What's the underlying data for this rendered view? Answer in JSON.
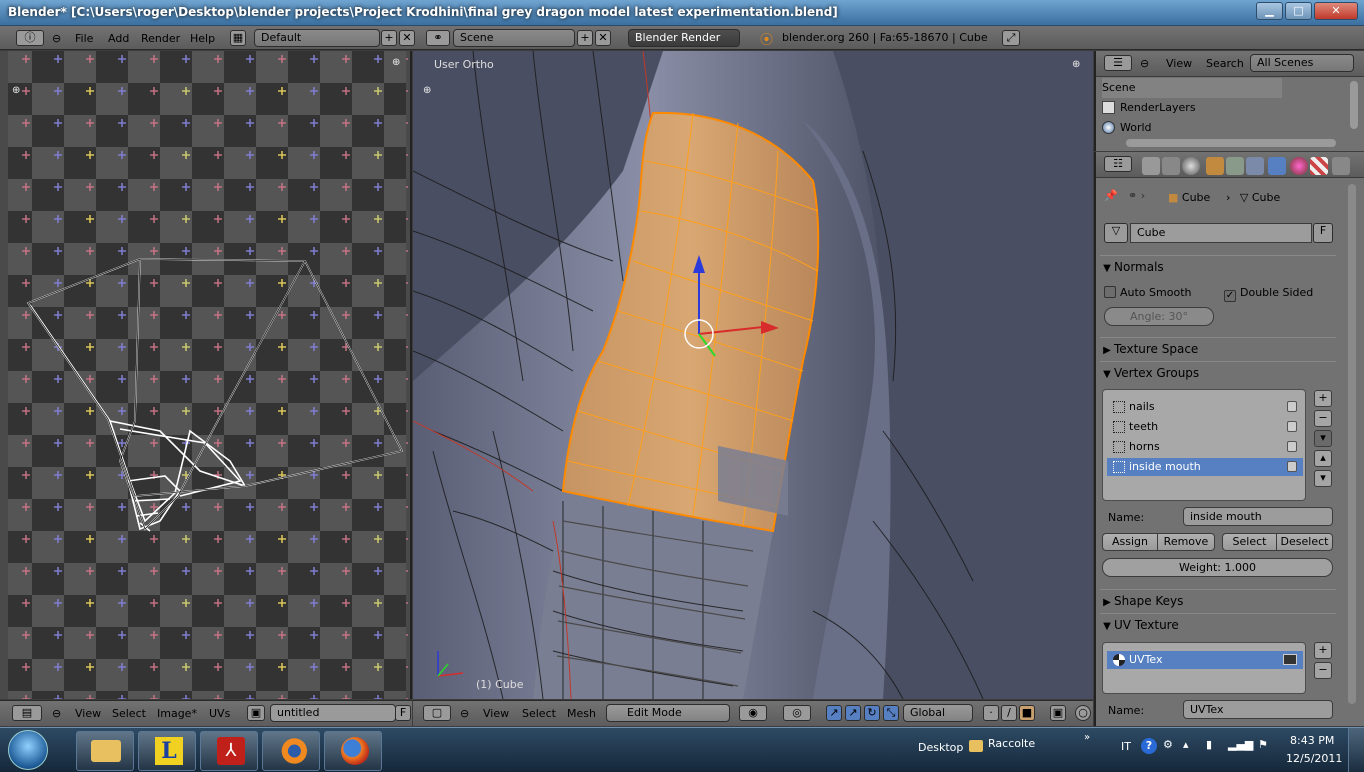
{
  "window": {
    "title": "Blender* [C:\\Users\\roger\\Desktop\\blender projects\\Project Krodhini\\final grey dragon model latest experimentation.blend]",
    "minimize": "▁",
    "maximize": "□",
    "close": "✕"
  },
  "menubar": {
    "items": [
      "File",
      "Add",
      "Render",
      "Help"
    ],
    "layout": "Default",
    "scene": "Scene",
    "engine": "Blender Render",
    "info": "blender.org 260 | Fa:65-18670 | Cube"
  },
  "uv_editor": {
    "menus": [
      "View",
      "Select",
      "Image*",
      "UVs"
    ],
    "image_name": "untitled",
    "fake_user": "F"
  },
  "viewport": {
    "view_label": "User Ortho",
    "object_label": "(1) Cube",
    "menus": [
      "View",
      "Select",
      "Mesh"
    ],
    "mode": "Edit Mode",
    "orientation": "Global"
  },
  "outliner": {
    "menus": [
      "View",
      "Search"
    ],
    "filter": "All Scenes",
    "rows": [
      "Scene",
      "RenderLayers",
      "World"
    ]
  },
  "properties": {
    "breadcrumb": [
      "Cube",
      "Cube"
    ],
    "mesh_name": "Cube",
    "fake_user": "F",
    "panels": {
      "normals": "Normals",
      "auto_smooth": "Auto Smooth",
      "double_sided": "Double Sided",
      "angle": "Angle: 30°",
      "texture_space": "Texture Space",
      "vertex_groups": "Vertex Groups",
      "shape_keys": "Shape Keys",
      "uv_texture": "UV Texture"
    },
    "vertex_groups": [
      "nails",
      "teeth",
      "horns",
      "inside mouth"
    ],
    "selected_group": "inside mouth",
    "name_label": "Name:",
    "group_name": "inside mouth",
    "buttons": [
      "Assign",
      "Remove",
      "Select",
      "Deselect"
    ],
    "weight": "Weight: 1.000",
    "uv_textures": [
      "UVTex"
    ],
    "uv_name_label": "Name:",
    "uv_name": "UVTex"
  },
  "taskbar": {
    "desktop": "Desktop",
    "folder": "Raccolte",
    "lang": "IT",
    "time": "8:43 PM",
    "date": "12/5/2011"
  }
}
